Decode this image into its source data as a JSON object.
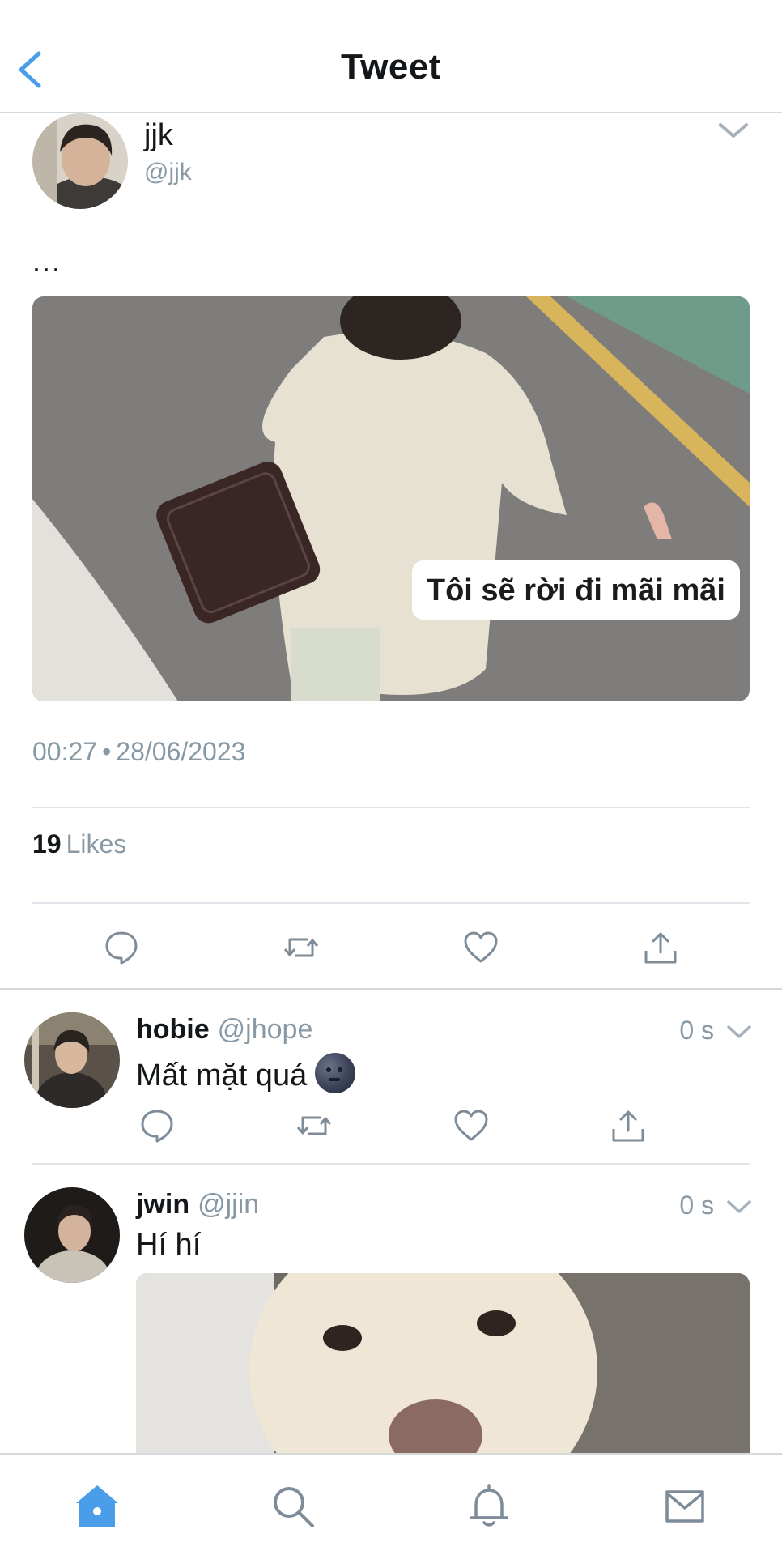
{
  "header": {
    "title": "Tweet",
    "back_icon": "chevron-left-icon"
  },
  "tweet": {
    "author_name": "jjk",
    "author_handle": "@jjk",
    "text": "...",
    "image_caption": "Tôi sẽ rời đi mãi mãi",
    "time": "00:27",
    "separator": "•",
    "date": "28/06/2023",
    "likes_count": "19",
    "likes_label": "Likes"
  },
  "replies": [
    {
      "name": "hobie",
      "handle": "@jhope",
      "time": "0 s",
      "text": "Mất mặt quá"
    },
    {
      "name": "jwin",
      "handle": "@jjin",
      "time": "0 s",
      "text": "Hí hí"
    }
  ],
  "tabbar": {
    "items": [
      "home-icon",
      "search-icon",
      "bell-icon",
      "mail-icon"
    ],
    "active": "home-icon"
  },
  "colors": {
    "accent": "#4a9de8",
    "icon_gray": "#7e8c99",
    "text_gray": "#8899a6",
    "divider": "#e1e4e8"
  }
}
